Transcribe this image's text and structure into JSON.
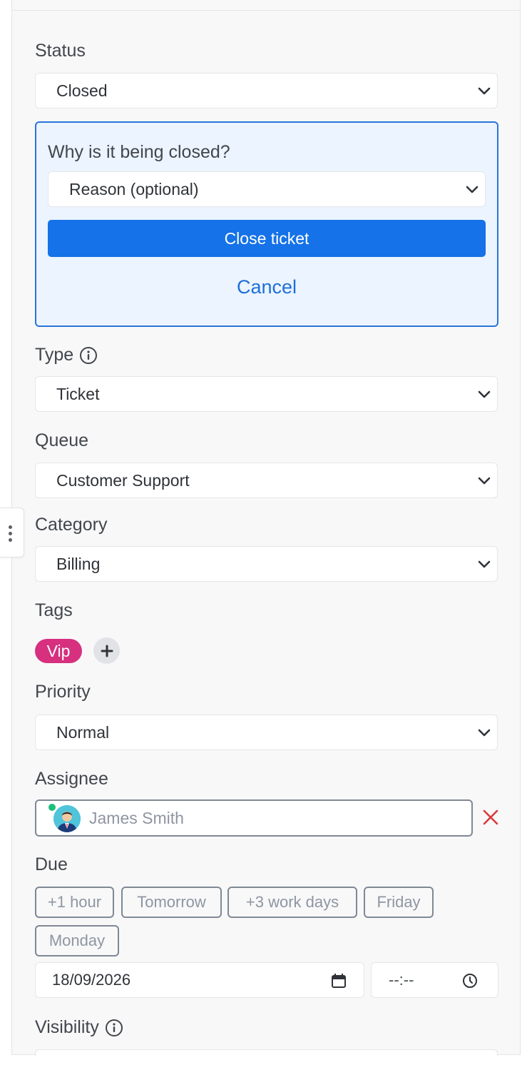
{
  "status": {
    "label": "Status",
    "value": "Closed"
  },
  "close_panel": {
    "question": "Why is it being closed?",
    "reason_placeholder": "Reason (optional)",
    "confirm_label": "Close ticket",
    "cancel_label": "Cancel"
  },
  "type": {
    "label": "Type",
    "value": "Ticket"
  },
  "queue": {
    "label": "Queue",
    "value": "Customer Support"
  },
  "category": {
    "label": "Category",
    "value": "Billing"
  },
  "tags": {
    "label": "Tags",
    "items": [
      "Vip"
    ]
  },
  "priority": {
    "label": "Priority",
    "value": "Normal"
  },
  "assignee": {
    "label": "Assignee",
    "name": "James Smith"
  },
  "due": {
    "label": "Due",
    "quick_options": [
      "+1 hour",
      "Tomorrow",
      "+3 work days",
      "Friday",
      "Monday"
    ],
    "date": "18/09/2026",
    "time": "--:--"
  },
  "visibility": {
    "label": "Visibility"
  },
  "colors": {
    "accent": "#1572e8",
    "tag_vip": "#d6307f",
    "remove": "#d93b3b",
    "online": "#1cbf79"
  },
  "icons": {
    "dropdown": "chevron-down-icon",
    "info": "info-icon",
    "add": "plus-icon",
    "remove": "close-icon",
    "calendar": "calendar-icon",
    "clock": "clock-icon",
    "handle": "more-vertical-icon"
  }
}
